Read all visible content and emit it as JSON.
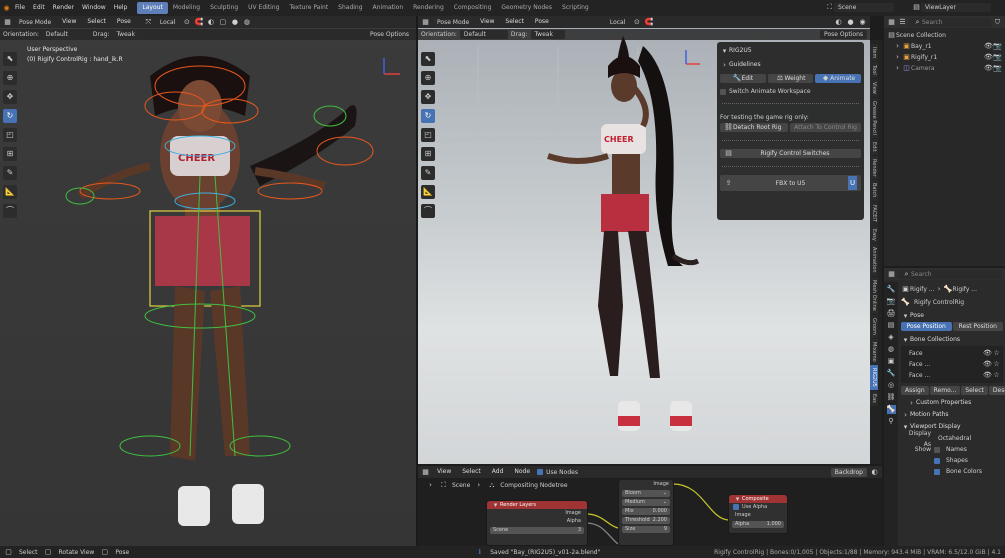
{
  "topbar": {
    "menus": [
      "File",
      "Edit",
      "Render",
      "Window",
      "Help"
    ],
    "workspaces": [
      "Layout",
      "Modeling",
      "Sculpting",
      "UV Editing",
      "Texture Paint",
      "Shading",
      "Animation",
      "Rendering",
      "Compositing",
      "Geometry Nodes",
      "Scripting"
    ],
    "scene": "Scene",
    "view_layer": "ViewLayer"
  },
  "left_viewport": {
    "mode": "Pose Mode",
    "menus": [
      "View",
      "Select",
      "Pose"
    ],
    "orientation_label": "Orientation:",
    "orientation": "Default",
    "drag_label": "Drag:",
    "drag": "Tweak",
    "transform": "Local",
    "options": "Pose Options",
    "view_name": "User Perspective",
    "object_info": "(0) Rigify ControlRig : hand_ik.R"
  },
  "right_viewport": {
    "mode": "Pose Mode",
    "menus": [
      "View",
      "Select",
      "Pose"
    ],
    "orientation_label": "Orientation:",
    "orientation": "Default",
    "drag_label": "Drag:",
    "drag": "Tweak",
    "transform": "Local",
    "options": "Pose Options"
  },
  "rig2u5": {
    "title": "RIG2U5",
    "guidelines": "Guidelines",
    "tabs": [
      "Edit",
      "Weight",
      "Animate"
    ],
    "switch_label": "Switch Animate Workspace",
    "testing_text": "For testing the game rig only:",
    "detach": "Detach Root Rig",
    "attach": "Attach To Control Rig",
    "control_switches": "Rigify Control Switches",
    "fbx": "FBX to U5"
  },
  "npanel_tabs": [
    "Item",
    "Tool",
    "View",
    "Grease Pencil",
    "Edit",
    "Render",
    "Batch",
    "FACEIT",
    "Easy",
    "Animation",
    "Mesh Online",
    "Groom",
    "Mixamo",
    "RIG2U5",
    "Eas"
  ],
  "node_editor": {
    "menus": [
      "View",
      "Select",
      "Add",
      "Node"
    ],
    "use_nodes": "Use Nodes",
    "backdrop": "Backdrop",
    "breadcrumb_scene": "Scene",
    "breadcrumb_tree": "Compositing Nodetree",
    "render_layers": {
      "title": "Render Layers",
      "outputs": [
        "Image",
        "Alpha"
      ],
      "scene": "Scene",
      "count": "3"
    },
    "glare": {
      "image_label": "Image",
      "type": "Bloom",
      "quality": "Medium",
      "mix_label": "Mix",
      "mix": "0.000",
      "threshold_label": "Threshold",
      "threshold": "2.200",
      "size_label": "Size",
      "size": "9"
    },
    "composite": {
      "title": "Composite",
      "use_alpha": "Use Alpha",
      "image": "Image",
      "alpha_label": "Alpha",
      "alpha": "1.000"
    }
  },
  "outliner": {
    "search": "Search",
    "items": [
      {
        "name": "Scene Collection"
      },
      {
        "name": "Bay_r1"
      },
      {
        "name": "Rigify_r1"
      },
      {
        "name": "Camera"
      }
    ]
  },
  "properties": {
    "search": "Search",
    "obj1": "Rigify ...",
    "obj2": "Rigify ...",
    "rig_name": "Rigify ControlRig",
    "pose": "Pose",
    "pose_position": "Pose Position",
    "rest_position": "Rest Position",
    "bone_collections": "Bone Collections",
    "collections": [
      "Face",
      "Face ...",
      "Face ..."
    ],
    "assign": "Assign",
    "remove": "Remo...",
    "select": "Select",
    "deselect": "Desel...",
    "custom_properties": "Custom Properties",
    "motion_paths": "Motion Paths",
    "viewport_display": "Viewport Display",
    "display_as_label": "Display As",
    "display_as": "Octahedral",
    "show_label": "Show",
    "show_items": [
      "Names",
      "Shapes",
      "Bone Colors"
    ]
  },
  "statusbar": {
    "select": "Select",
    "rotate": "Rotate View",
    "pose": "Pose",
    "saved": "Saved \"Bay_(RIG2U5)_v01-2a.blend\"",
    "info": "Rigify ControlRig | Bones:0/1,005 | Objects:1/88 | Memory: 943.4 MiB | VRAM: 6.5/12.0 GiB | 4.1"
  },
  "colors": {
    "accent": "#4772b3",
    "node_red": "#a03333",
    "node_gray": "#4b4b4b"
  }
}
